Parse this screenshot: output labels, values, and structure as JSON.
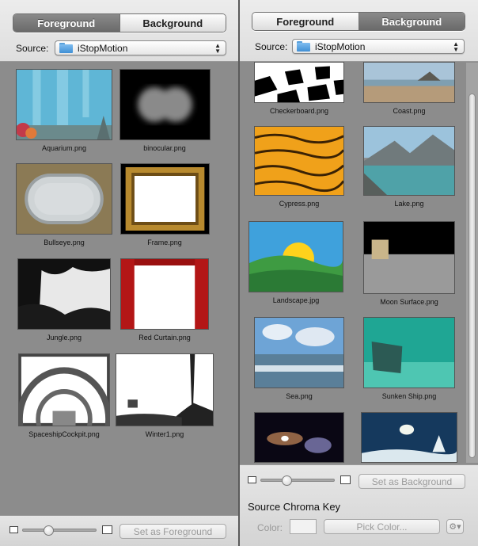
{
  "left_panel": {
    "tabs": [
      {
        "label": "Foreground",
        "active": true
      },
      {
        "label": "Background",
        "active": false
      }
    ],
    "source": {
      "label": "Source:",
      "value": "iStopMotion"
    },
    "items": [
      {
        "name": "Aquarium.png",
        "thumb": "aquarium"
      },
      {
        "name": "binocular.png",
        "thumb": "binocular"
      },
      {
        "name": "Bullseye.png",
        "thumb": "bullseye"
      },
      {
        "name": "Frame.png",
        "thumb": "frame"
      },
      {
        "name": "Jungle.png",
        "thumb": "jungle"
      },
      {
        "name": "Red Curtain.png",
        "thumb": "curtain"
      },
      {
        "name": "SpaceshipCockpit.png",
        "thumb": "cockpit"
      },
      {
        "name": "Winter1.png",
        "thumb": "winter"
      }
    ],
    "zoom": {
      "level": 0.35
    },
    "set_button": "Set as Foreground"
  },
  "right_panel": {
    "tabs": [
      {
        "label": "Foreground",
        "active": false
      },
      {
        "label": "Background",
        "active": true
      }
    ],
    "source": {
      "label": "Source:",
      "value": "iStopMotion"
    },
    "items": [
      {
        "name": "Checkerboard.png",
        "thumb": "checker"
      },
      {
        "name": "Coast.png",
        "thumb": "coast"
      },
      {
        "name": "Cypress.png",
        "thumb": "cypress"
      },
      {
        "name": "Lake.png",
        "thumb": "lake"
      },
      {
        "name": "Landscape.jpg",
        "thumb": "landscape"
      },
      {
        "name": "Moon Surface.png",
        "thumb": "moon"
      },
      {
        "name": "Sea.png",
        "thumb": "sea"
      },
      {
        "name": "Sunken Ship.png",
        "thumb": "ship"
      },
      {
        "name": "",
        "thumb": "galaxy"
      },
      {
        "name": "",
        "thumb": "snow"
      }
    ],
    "zoom": {
      "level": 0.35
    },
    "set_button": "Set as Background",
    "chroma": {
      "title": "Source Chroma Key",
      "color_label": "Color:",
      "pick_button": "Pick Color...",
      "gear_icon": "gear-icon"
    }
  },
  "colors": {
    "panel_bg": "#8c8c8c",
    "active_tab": "#707070"
  }
}
